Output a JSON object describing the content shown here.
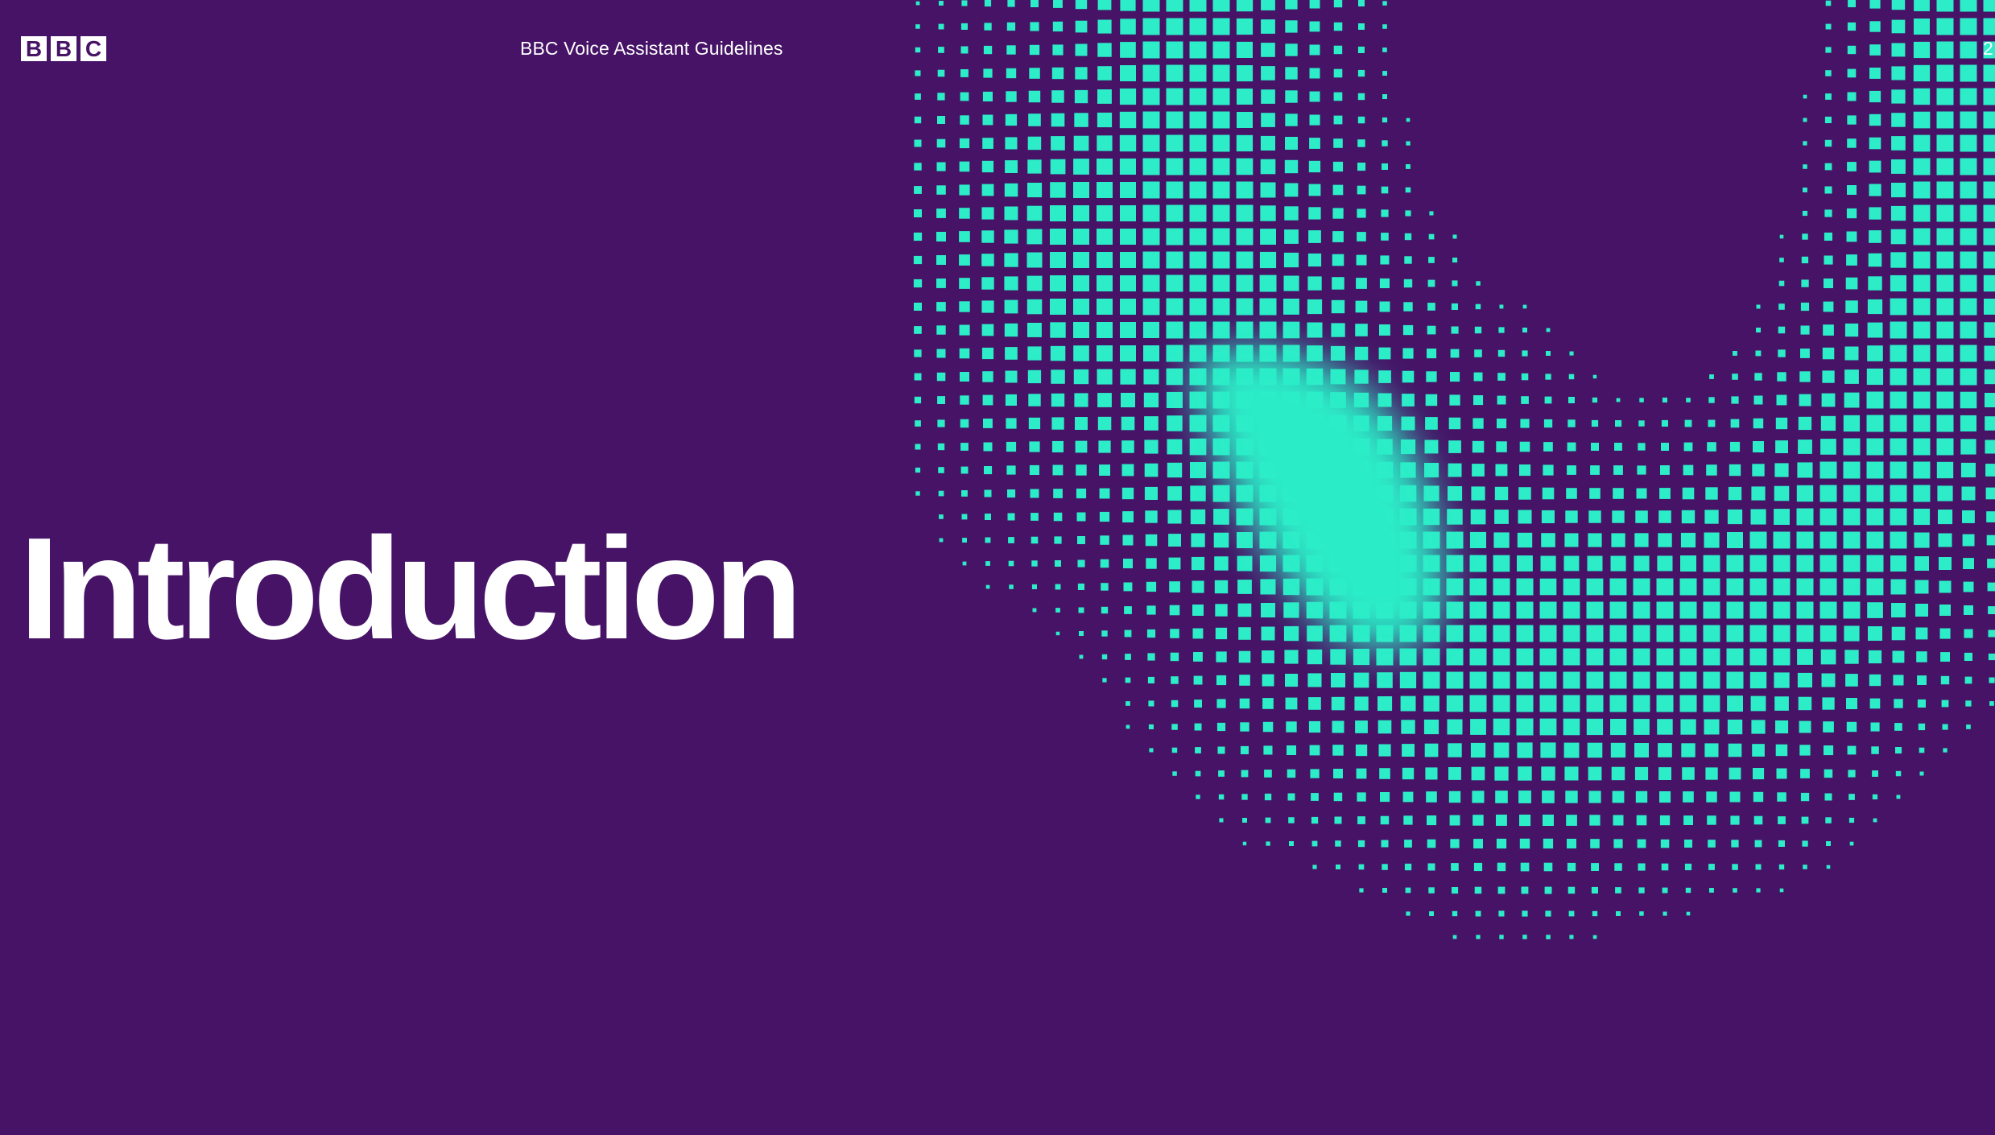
{
  "header": {
    "logo_text": "BBC",
    "document_title": "BBC Voice Assistant Guidelines",
    "page_number": "2"
  },
  "slide": {
    "heading": "Introduction"
  },
  "colors": {
    "background": "#461366",
    "accent": "#2cedc8",
    "text": "#ffffff"
  },
  "decoration": {
    "icon": "halftone-wave-pattern"
  }
}
